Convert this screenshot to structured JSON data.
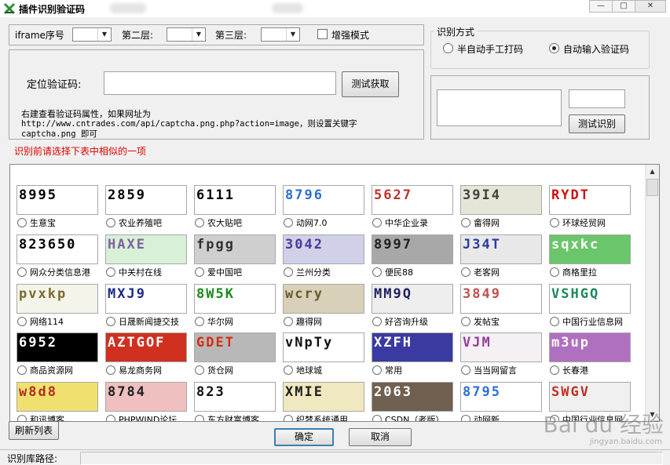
{
  "window": {
    "title": "插件识别验证码",
    "minimize": "—",
    "maximize": "□",
    "close": "✕"
  },
  "frame": {
    "iframe_label": "iframe序号",
    "layer2_label": "第二层:",
    "layer3_label": "第三层:",
    "enhanced_label": "增强模式"
  },
  "locate": {
    "label": "定位验证码:",
    "test_button": "测试获取",
    "hint_line1": "右建查看验证码属性，如果网址为",
    "hint_line2": "http://www.cntrades.com/api/captcha.png.php?action=image，则设置关键字",
    "hint_line3": "captcha.png 即可"
  },
  "method": {
    "title": "识别方式",
    "semi_auto": "半自动手工打码",
    "auto": "自动输入验证码"
  },
  "test": {
    "button": "测试识别"
  },
  "notice": "识别前请选择下表中相似的一项",
  "captchas": [
    {
      "text": "8995",
      "label": "生意宝",
      "color": "#000000",
      "bg": "#ffffff"
    },
    {
      "text": "2859",
      "label": "农业养殖吧",
      "color": "#000000",
      "bg": "#ffffff"
    },
    {
      "text": "6111",
      "label": "农大贴吧",
      "color": "#000000",
      "bg": "#ffffff"
    },
    {
      "text": "8796",
      "label": "动网7.0",
      "color": "#2a6fd6",
      "bg": "#ffffff"
    },
    {
      "text": "5627",
      "label": "中华企业录",
      "color": "#c03030",
      "bg": "#ffffff"
    },
    {
      "text": "39I4",
      "label": "畲得网",
      "color": "#404040",
      "bg": "#e6e6d8"
    },
    {
      "text": "RYDT",
      "label": "环球经贸网",
      "color": "#d01010",
      "bg": "#ffffff"
    },
    {
      "text": "823650",
      "label": "网众分类信息港",
      "color": "#000000",
      "bg": "#ffffff"
    },
    {
      "text": "HAXE",
      "label": "中关村在线",
      "color": "#8060a0",
      "bg": "#d8f0d8"
    },
    {
      "text": "fpgg",
      "label": "爱中国吧",
      "color": "#303030",
      "bg": "#cfcfcf"
    },
    {
      "text": "3042",
      "label": "兰州分类",
      "color": "#4a3a9a",
      "bg": "#d0d0e8"
    },
    {
      "text": "8997",
      "label": "便民88",
      "color": "#202020",
      "bg": "#a8a8a8"
    },
    {
      "text": "J34T",
      "label": "老客网",
      "color": "#2a3aa0",
      "bg": "#e8e8e8"
    },
    {
      "text": "sqxkc",
      "label": "商格里拉",
      "color": "#ffffff",
      "bg": "#6ac66a"
    },
    {
      "text": "pvxkp",
      "label": "网络114",
      "color": "#7a6a2a",
      "bg": "#f4f4ea"
    },
    {
      "text": "MXJ9",
      "label": "日晟新闻捷交技",
      "color": "#1a2a8a",
      "bg": "#ffffff"
    },
    {
      "text": "8W5K",
      "label": "华尔网",
      "color": "#1a8a1a",
      "bg": "#ffffff"
    },
    {
      "text": "wcry",
      "label": "趣得网",
      "color": "#6a5a2a",
      "bg": "#d8d0b8"
    },
    {
      "text": "MM9Q",
      "label": "好咨询升级",
      "color": "#202060",
      "bg": "#eeeeee"
    },
    {
      "text": "3849",
      "label": "发帖宝",
      "color": "#c05050",
      "bg": "#ffffff"
    },
    {
      "text": "VSHGQ",
      "label": "中国行业信息网",
      "color": "#1a8a5a",
      "bg": "#ffffff"
    },
    {
      "text": "6952",
      "label": "商品资源网",
      "color": "#ffffff",
      "bg": "#000000"
    },
    {
      "text": "AZTGOF",
      "label": "易龙商务网",
      "color": "#ffffff",
      "bg": "#d03020"
    },
    {
      "text": "GDET",
      "label": "货仓网",
      "color": "#d03010",
      "bg": "#b8b8b8"
    },
    {
      "text": "vNpTy",
      "label": "地球城",
      "color": "#101010",
      "bg": "#ffffff"
    },
    {
      "text": "XZFH",
      "label": "常用",
      "color": "#ffffff",
      "bg": "#3a3aa0"
    },
    {
      "text": "VJM",
      "label": "当当网留言",
      "color": "#9a3a9a",
      "bg": "#f4f0f4"
    },
    {
      "text": "m3up",
      "label": "长春港",
      "color": "#ffffff",
      "bg": "#b070c0"
    },
    {
      "text": "w8d8",
      "label": "和讯博客",
      "color": "#b03020",
      "bg": "#f0e070"
    },
    {
      "text": "8784",
      "label": "PHPWIND论坛",
      "color": "#202020",
      "bg": "#f0c0c0"
    },
    {
      "text": "823",
      "label": "东方财富博客",
      "color": "#101010",
      "bg": "#ffffff"
    },
    {
      "text": "XMIE",
      "label": "织梦系统通用",
      "color": "#202020",
      "bg": "#f0e8c0"
    },
    {
      "text": "2063",
      "label": "CSDN（老版）",
      "color": "#ffffff",
      "bg": "#706050"
    },
    {
      "text": "8795",
      "label": "动网新",
      "color": "#2a6fd6",
      "bg": "#ffffff"
    },
    {
      "text": "SWGV",
      "label": "中国行业信息网",
      "color": "#c03020",
      "bg": "#f0f0f0"
    }
  ],
  "buttons": {
    "refresh": "刷新列表",
    "ok": "确定",
    "cancel": "取消"
  },
  "status": {
    "path_label": "识别库路径:"
  },
  "watermark": {
    "main": "Bai du 经验",
    "sub": "jingyan.baidu.com"
  }
}
